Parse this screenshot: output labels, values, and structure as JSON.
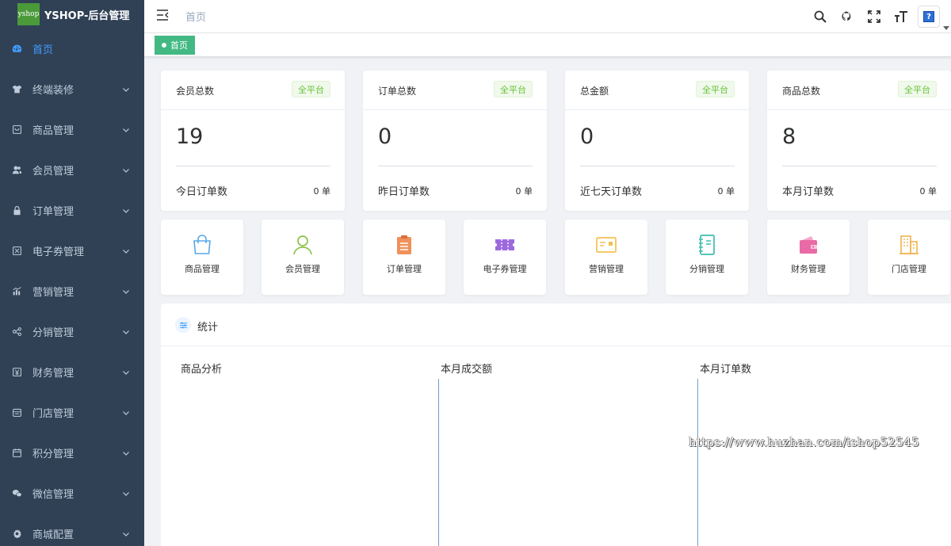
{
  "brand": {
    "logo_text": "yshop",
    "title": "YSHOP-后台管理"
  },
  "sidebar": {
    "items": [
      {
        "label": "首页",
        "icon": "dashboard-icon",
        "active": true
      },
      {
        "label": "终端装修",
        "icon": "shirt-icon"
      },
      {
        "label": "商品管理",
        "icon": "goods-icon"
      },
      {
        "label": "会员管理",
        "icon": "peoples-icon"
      },
      {
        "label": "订单管理",
        "icon": "lock-icon"
      },
      {
        "label": "电子券管理",
        "icon": "coupon-icon"
      },
      {
        "label": "营销管理",
        "icon": "chart-icon"
      },
      {
        "label": "分销管理",
        "icon": "share-icon"
      },
      {
        "label": "财务管理",
        "icon": "finance-icon"
      },
      {
        "label": "门店管理",
        "icon": "store-icon"
      },
      {
        "label": "积分管理",
        "icon": "calendar-icon"
      },
      {
        "label": "微信管理",
        "icon": "wechat-icon"
      },
      {
        "label": "商城配置",
        "icon": "gear-icon"
      }
    ]
  },
  "header": {
    "breadcrumb": "首页"
  },
  "tags": {
    "active_tag": "首页"
  },
  "stat_cards": [
    {
      "title": "会员总数",
      "badge": "全平台",
      "value": "19",
      "footer_label": "今日订单数",
      "footer_value": "0 单"
    },
    {
      "title": "订单总数",
      "badge": "全平台",
      "value": "0",
      "footer_label": "昨日订单数",
      "footer_value": "0 单"
    },
    {
      "title": "总金额",
      "badge": "全平台",
      "value": "0",
      "footer_label": "近七天订单数",
      "footer_value": "0 单"
    },
    {
      "title": "商品总数",
      "badge": "全平台",
      "value": "8",
      "footer_label": "本月订单数",
      "footer_value": "0 单"
    }
  ],
  "quick_nav": [
    {
      "label": "商品管理",
      "icon": "shopping-bag-icon",
      "color": "#5aa8e6"
    },
    {
      "label": "会员管理",
      "icon": "user-icon",
      "color": "#8bc34a"
    },
    {
      "label": "订单管理",
      "icon": "clipboard-icon",
      "color": "#f0905a"
    },
    {
      "label": "电子券管理",
      "icon": "ticket-icon",
      "color": "#9c6ade"
    },
    {
      "label": "营销管理",
      "icon": "card-icon",
      "color": "#f2c14e"
    },
    {
      "label": "分销管理",
      "icon": "notebook-icon",
      "color": "#3dbdb0"
    },
    {
      "label": "财务管理",
      "icon": "wallet-icon",
      "color": "#e86aa6"
    },
    {
      "label": "门店管理",
      "icon": "building-icon",
      "color": "#f2b24e"
    }
  ],
  "stats": {
    "title": "统计",
    "charts": [
      "商品分析",
      "本月成交额",
      "本月订单数"
    ]
  },
  "watermark": "https://www.huzhan.com/ishop52545"
}
